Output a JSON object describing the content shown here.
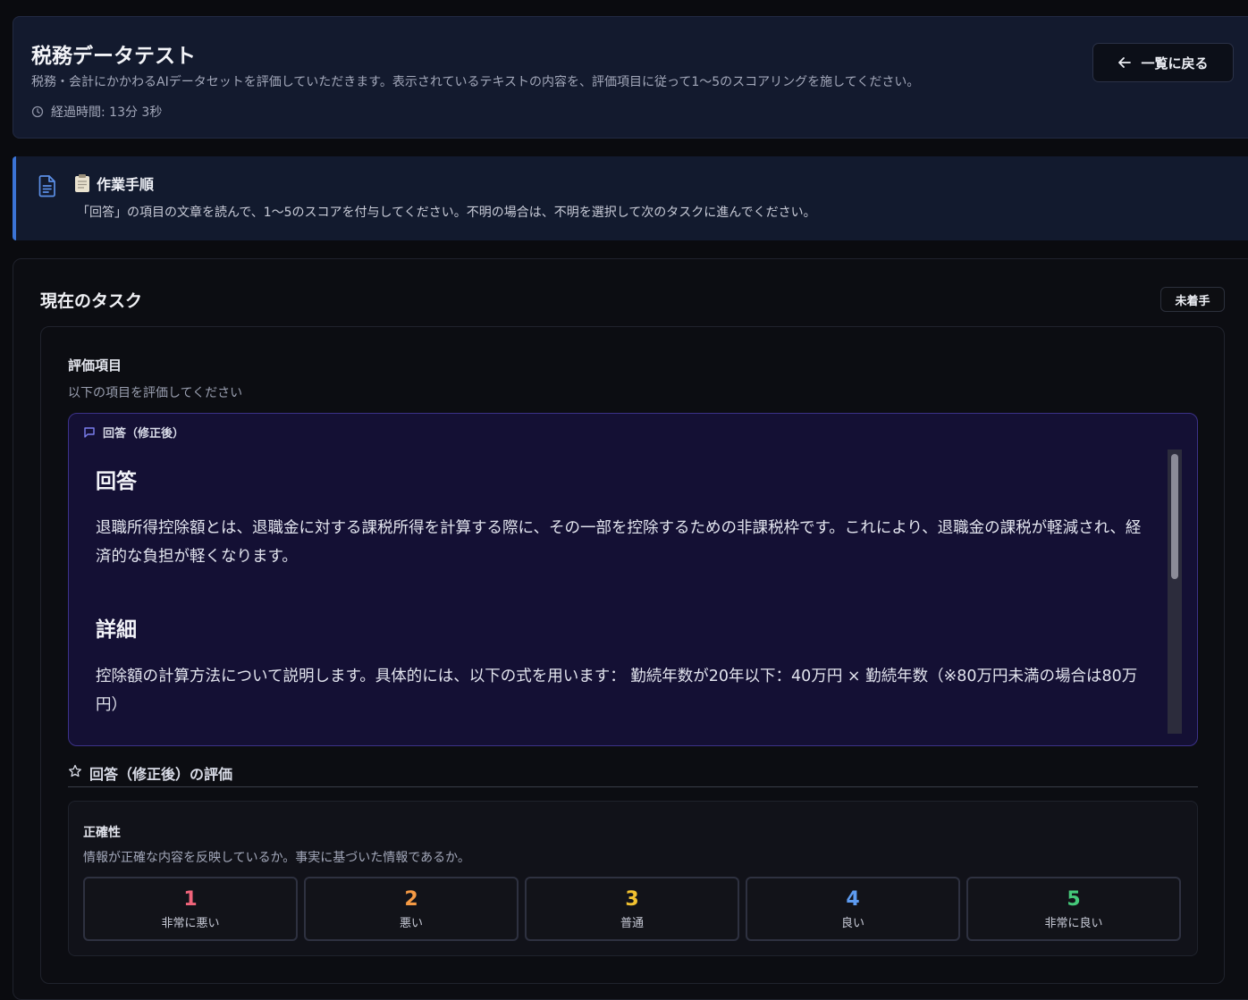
{
  "header": {
    "title": "税務データテスト",
    "description": "税務・会計にかかわるAIデータセットを評価していただきます。表示されているテキストの内容を、評価項目に従って1〜5のスコアリングを施してください。",
    "elapsed": "経過時間: 13分 3秒",
    "back_label": "一覧に戻る"
  },
  "instructions": {
    "title": "作業手順",
    "text": "「回答」の項目の文章を読んで、1〜5のスコアを付与してください。不明の場合は、不明を選択して次のタスクに進んでください。"
  },
  "task": {
    "title": "現在のタスク",
    "status": "未着手",
    "evaluation": {
      "title": "評価項目",
      "subtitle": "以下の項目を評価してください",
      "answer": {
        "label": "回答（修正後）",
        "heading1": "回答",
        "para1": "退職所得控除額とは、退職金に対する課税所得を計算する際に、その一部を控除するための非課税枠です。これにより、退職金の課税が軽減され、経済的な負担が軽くなります。",
        "heading2": "詳細",
        "para2": "控除額の計算方法について説明します。具体的には、以下の式を用います： 勤続年数が20年以下：40万円 × 勤続年数（※80万円未満の場合は80万円）"
      },
      "rating_title": "回答（修正後）の評価",
      "criteria": {
        "name": "正確性",
        "description": "情報が正確な内容を反映しているか。事実に基づいた情報であるか。",
        "scores": [
          {
            "value": "1",
            "label": "非常に悪い",
            "color": "#f0647a"
          },
          {
            "value": "2",
            "label": "悪い",
            "color": "#f59a44"
          },
          {
            "value": "3",
            "label": "普通",
            "color": "#f2c230"
          },
          {
            "value": "4",
            "label": "良い",
            "color": "#5d9bf0"
          },
          {
            "value": "5",
            "label": "非常に良い",
            "color": "#45c97a"
          }
        ]
      }
    }
  }
}
